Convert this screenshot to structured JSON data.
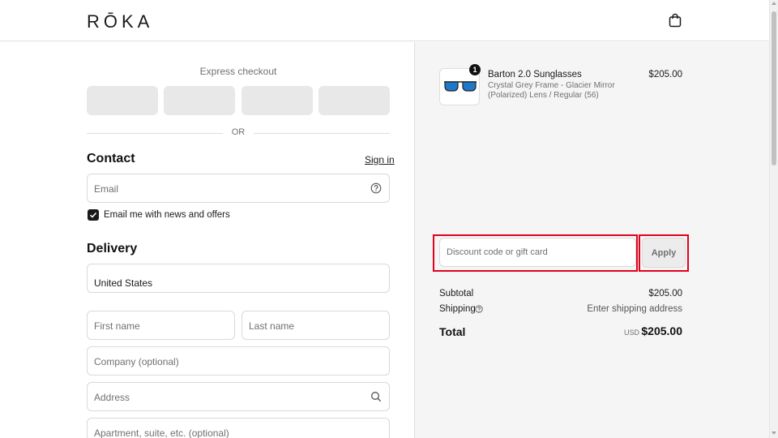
{
  "header": {
    "logo": "RŌKA",
    "cart_icon": "shopping-bag-icon"
  },
  "express": {
    "label": "Express checkout",
    "divider": "OR"
  },
  "contact": {
    "title": "Contact",
    "sign_in": "Sign in",
    "email_placeholder": "Email",
    "email_help_icon": "help-circle-icon",
    "newsletter_label": "Email me with news and offers",
    "newsletter_checked": true
  },
  "delivery": {
    "title": "Delivery",
    "country_value": "United States",
    "first_name_placeholder": "First name",
    "last_name_placeholder": "Last name",
    "company_placeholder": "Company (optional)",
    "address_placeholder": "Address",
    "address_icon": "search-icon",
    "apartment_placeholder": "Apartment, suite, etc. (optional)"
  },
  "cart": {
    "item": {
      "quantity": "1",
      "name": "Barton 2.0 Sunglasses",
      "variant": "Crystal Grey Frame - Glacier Mirror (Polarized) Lens / Regular (56)",
      "price": "$205.00"
    },
    "discount_placeholder": "Discount code or gift card",
    "apply_label": "Apply"
  },
  "summary": {
    "subtotal_label": "Subtotal",
    "subtotal_value": "$205.00",
    "shipping_label": "Shipping",
    "shipping_value": "Enter shipping address",
    "total_label": "Total",
    "currency": "USD",
    "total_value": "$205.00"
  },
  "colors": {
    "highlight": "#e3001b",
    "panel_bg": "#f5f5f5",
    "express_btn": "#e8e8e8"
  }
}
